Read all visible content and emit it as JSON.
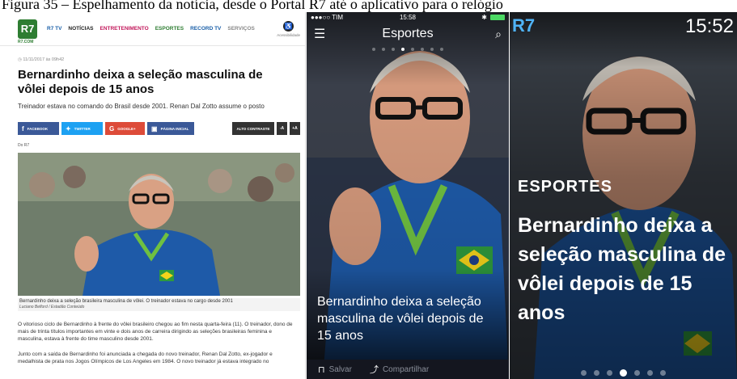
{
  "figure_caption": "Figura 35 – Espelhamento da notícia, desde o Portal R7 até o aplicativo para o relógio",
  "desktop": {
    "logo": "R7",
    "logo_sub": "R7.COM",
    "nav": [
      "R7 TV",
      "NOTÍCIAS",
      "ENTRETENIMENTO",
      "ESPORTES",
      "RECORD TV",
      "SERVIÇOS"
    ],
    "accessibility_label": "Acessibilidade",
    "date": "11/11/2017 às 09h42",
    "headline": "Bernardinho deixa a seleção masculina de vôlei depois de 15 anos",
    "subheadline": "Treinador estava no comando do Brasil desde 2001. Renan Dal Zotto assume o posto",
    "share": {
      "facebook": "FACEBOOK",
      "twitter": "TWITTER",
      "google": "GOOGLE+",
      "home": "PÁGINA INICIAL"
    },
    "controls": {
      "contrast": "ALTO CONTRASTE",
      "decrease": "-A",
      "increase": "+A"
    },
    "source": "Do R7",
    "photo_caption": "Bernardinho deixa a seleção brasileira masculina de vôlei. O treinador estava no cargo desde 2001",
    "photo_credit": "Luciano Belford / Estadão Conteúdo",
    "body_p1": "O vitorioso ciclo de Bernardinho à frente do vôlei brasileiro chegou ao fim nesta quarta-feira (11). O treinador, dono de mais de trinta títulos importantes em vinte e dois anos de carreira dirigindo as seleções brasileiras feminina e masculina, estava à frente do time masculino desde 2001.",
    "body_p2": "Junto com a saída de Bernardinho foi anunciada a chegada do novo treinador, Renan Dal Zotto, ex-jogador e medalhista de prata nos Jogos Olímpicos de Los Angeles em 1984. O novo treinador já estava integrado no"
  },
  "phone": {
    "carrier": "●●●○○ TIM",
    "time": "15:58",
    "bluetooth": "✱",
    "section_title": "Esportes",
    "menu_icon": "menu-icon",
    "search_icon": "search-icon",
    "page_dots": 8,
    "active_dot": 4,
    "headline": "Bernardinho deixa a seleção masculina de vôlei depois de 15 anos",
    "save_label": "Salvar",
    "share_label": "Compartilhar"
  },
  "watch": {
    "brand": "R7",
    "time": "15:52",
    "category": "ESPORTES",
    "headline": "Bernardinho deixa a seleção masculina de vôlei depois de 15 anos",
    "page_dots": 7,
    "active_dot": 4
  },
  "colors": {
    "r7_green": "#2e7d32",
    "facebook": "#3b5998",
    "twitter": "#1da1f2",
    "google": "#dd4b39",
    "watch_brand": "#4fb3f6",
    "jersey_blue": "#1e5aa8"
  }
}
